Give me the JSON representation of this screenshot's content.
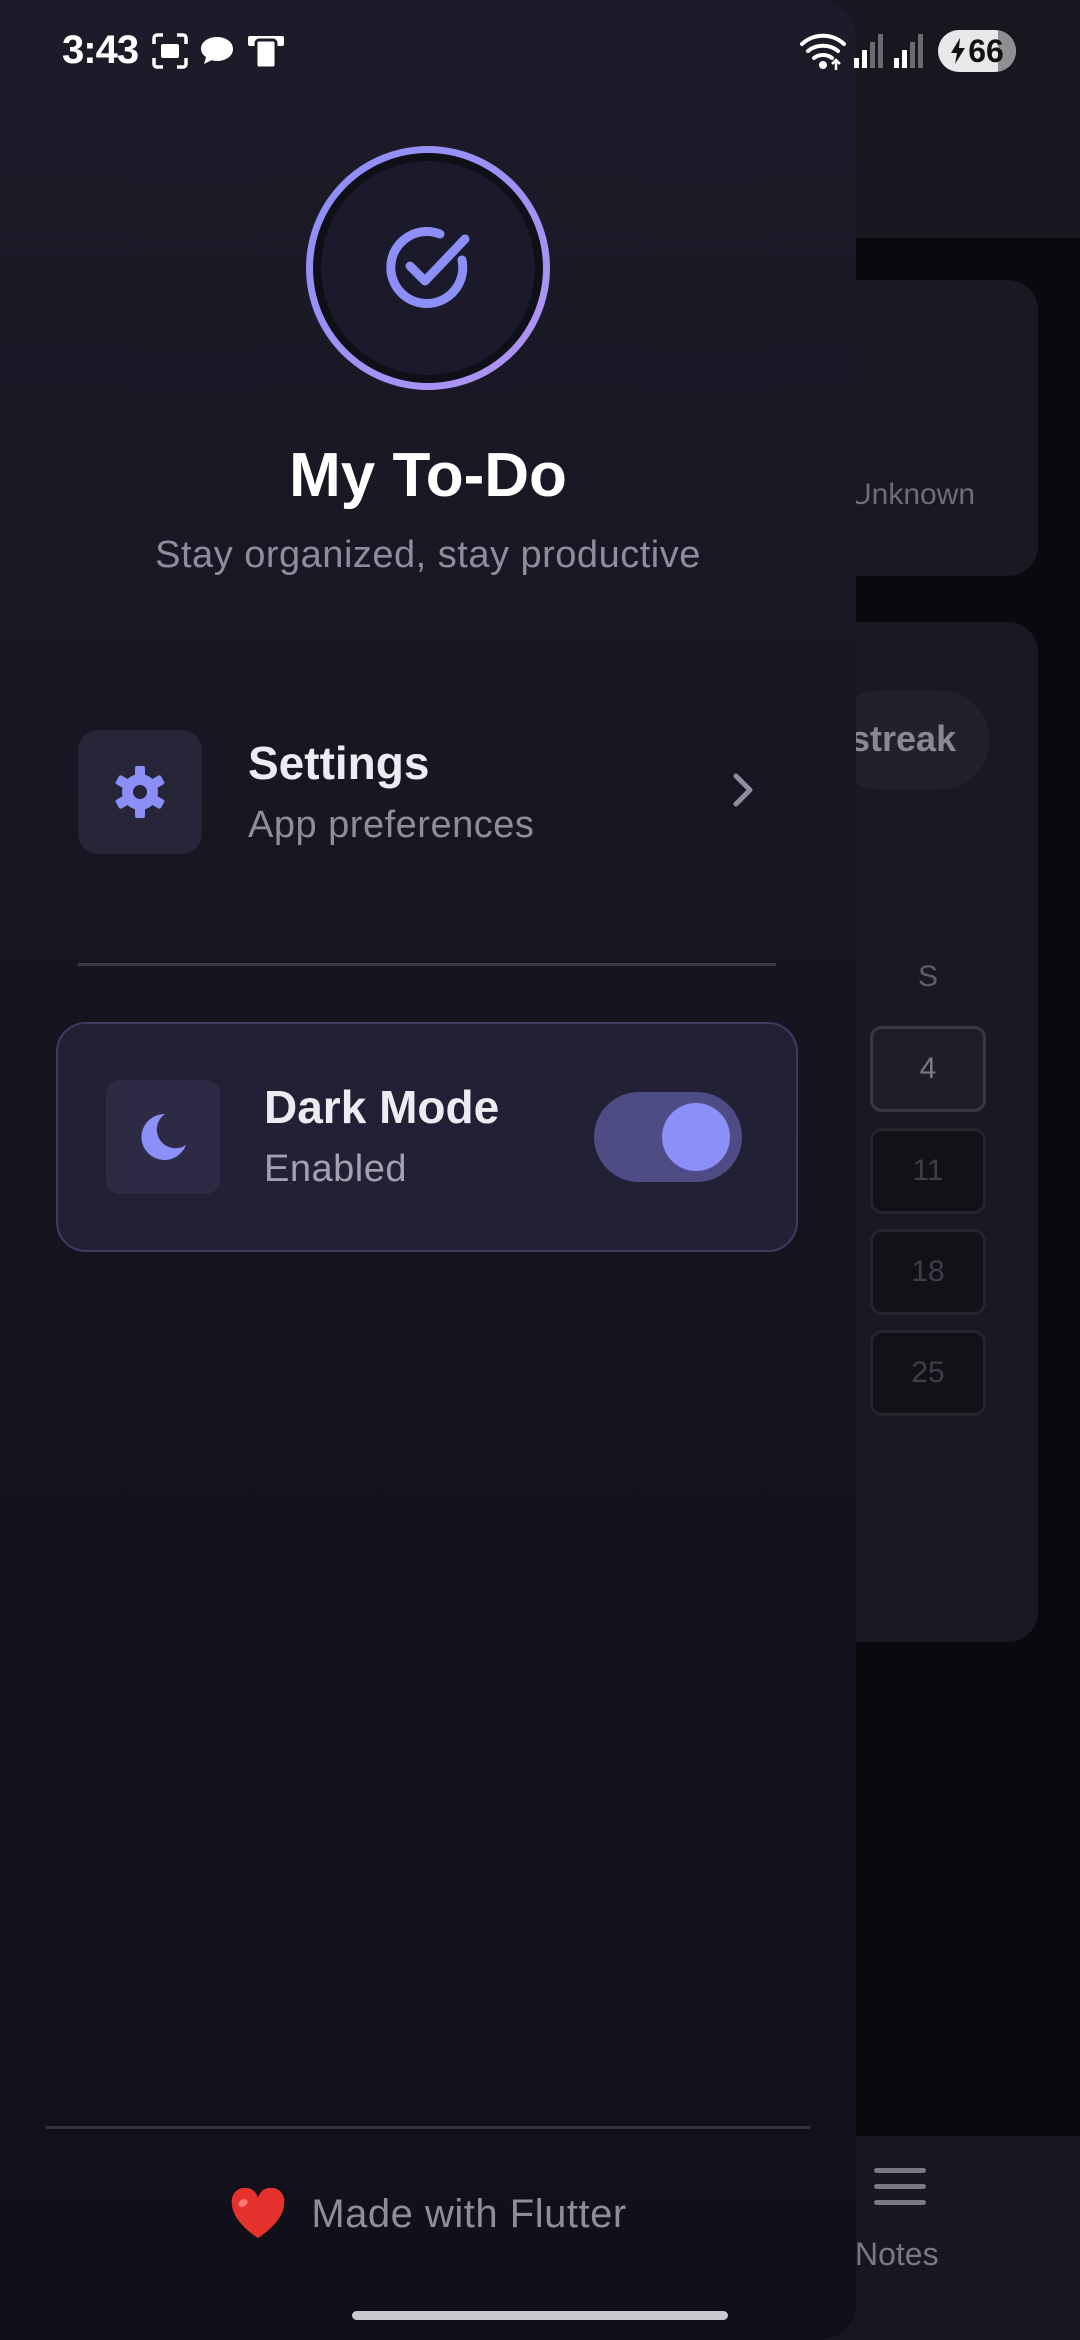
{
  "status_bar": {
    "time": "3:43",
    "battery": "66"
  },
  "drawer": {
    "app_title": "My To-Do",
    "app_subtitle": "Stay organized, stay productive",
    "settings": {
      "label": "Settings",
      "subtitle": "App preferences"
    },
    "dark_mode": {
      "label": "Dark Mode",
      "status": "Enabled",
      "enabled": true
    },
    "footer_text": "Made with Flutter"
  },
  "background_app": {
    "unknown_label": "Unknown",
    "streak_label": "streak",
    "day_header": "S",
    "day_numbers": [
      "4",
      "11",
      "18",
      "25"
    ],
    "nav_notes_label": "Notes"
  },
  "colors": {
    "accent": "#8c8ff8",
    "drawer_bg": "#1d1b29",
    "card_bg": "#222034",
    "heart": "#e5322d"
  },
  "icons": {
    "logo": "check-circle-icon",
    "settings": "gear-icon",
    "chevron": "chevron-right-icon",
    "dark_mode": "moon-icon",
    "footer": "heart-icon",
    "notes": "notes-icon"
  }
}
